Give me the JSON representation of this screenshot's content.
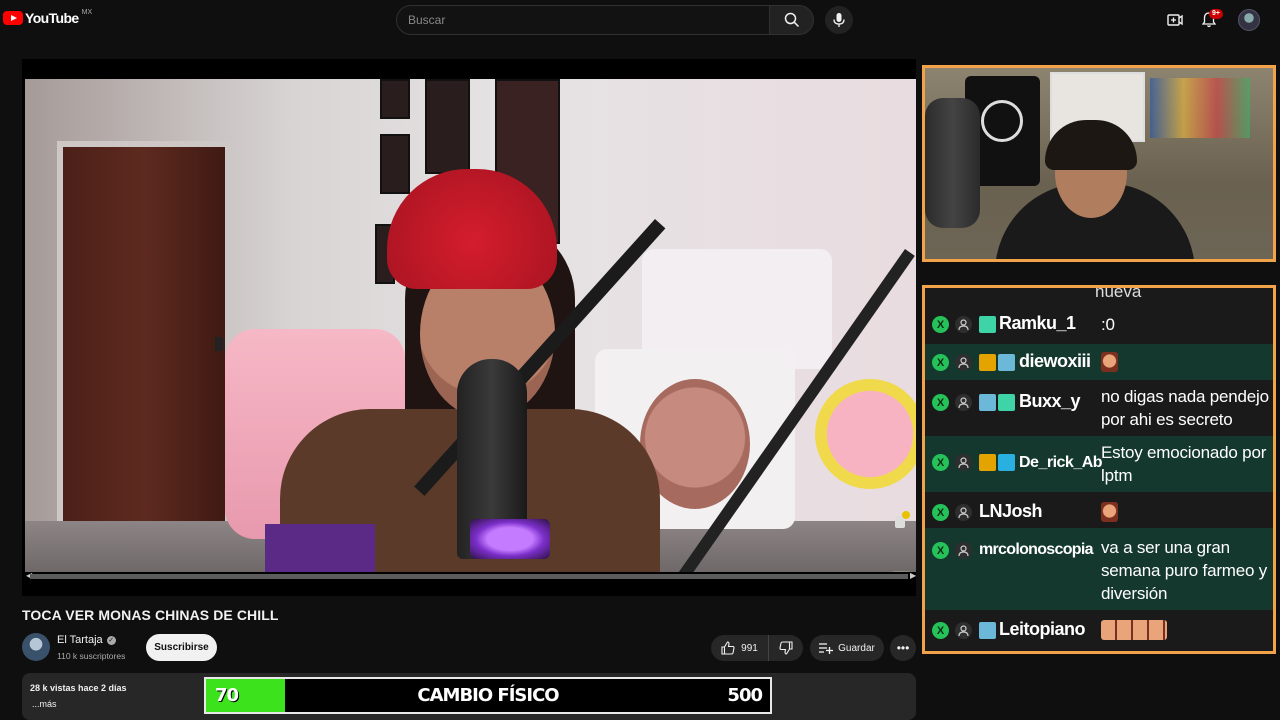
{
  "app": {
    "logo_text": "YouTube",
    "logo_country": "MX",
    "notifications_count": "9+"
  },
  "search": {
    "placeholder": "Buscar"
  },
  "video": {
    "title": "TOCA VER MONAS CHINAS DE CHILL",
    "channel_name": "El Tartaja",
    "subscribers": "110 k suscriptores",
    "subscribe_label": "Suscribirse",
    "likes": "991",
    "save_label": "Guardar",
    "views_and_date": "28 k vistas  hace 2 días",
    "more_label": "...más"
  },
  "goal": {
    "current": "70",
    "title": "CAMBIO FÍSICO",
    "target": "500",
    "progress_fraction": 0.14,
    "fill_color": "#3ce31d"
  },
  "chat": {
    "partial_top": "nueva",
    "messages": [
      {
        "user": "Ramku_1",
        "text": ":0"
      },
      {
        "user": "diewoxiii",
        "text": ""
      },
      {
        "user": "Buxx_y",
        "text": "no digas nada pendejo por ahi es secreto"
      },
      {
        "user": "De_rick_Ab",
        "text": "Estoy emocionado por lptm"
      },
      {
        "user": "LNJosh",
        "text": ""
      },
      {
        "user": "mrcolonoscopia",
        "text": "va a ser una gran semana puro farmeo y diversión"
      },
      {
        "user": "Leitopiano",
        "text": ""
      }
    ]
  },
  "colors": {
    "overlay_border": "#f2a34a",
    "chat_highlight": "#14382d",
    "badge_green": "#25c25a"
  }
}
